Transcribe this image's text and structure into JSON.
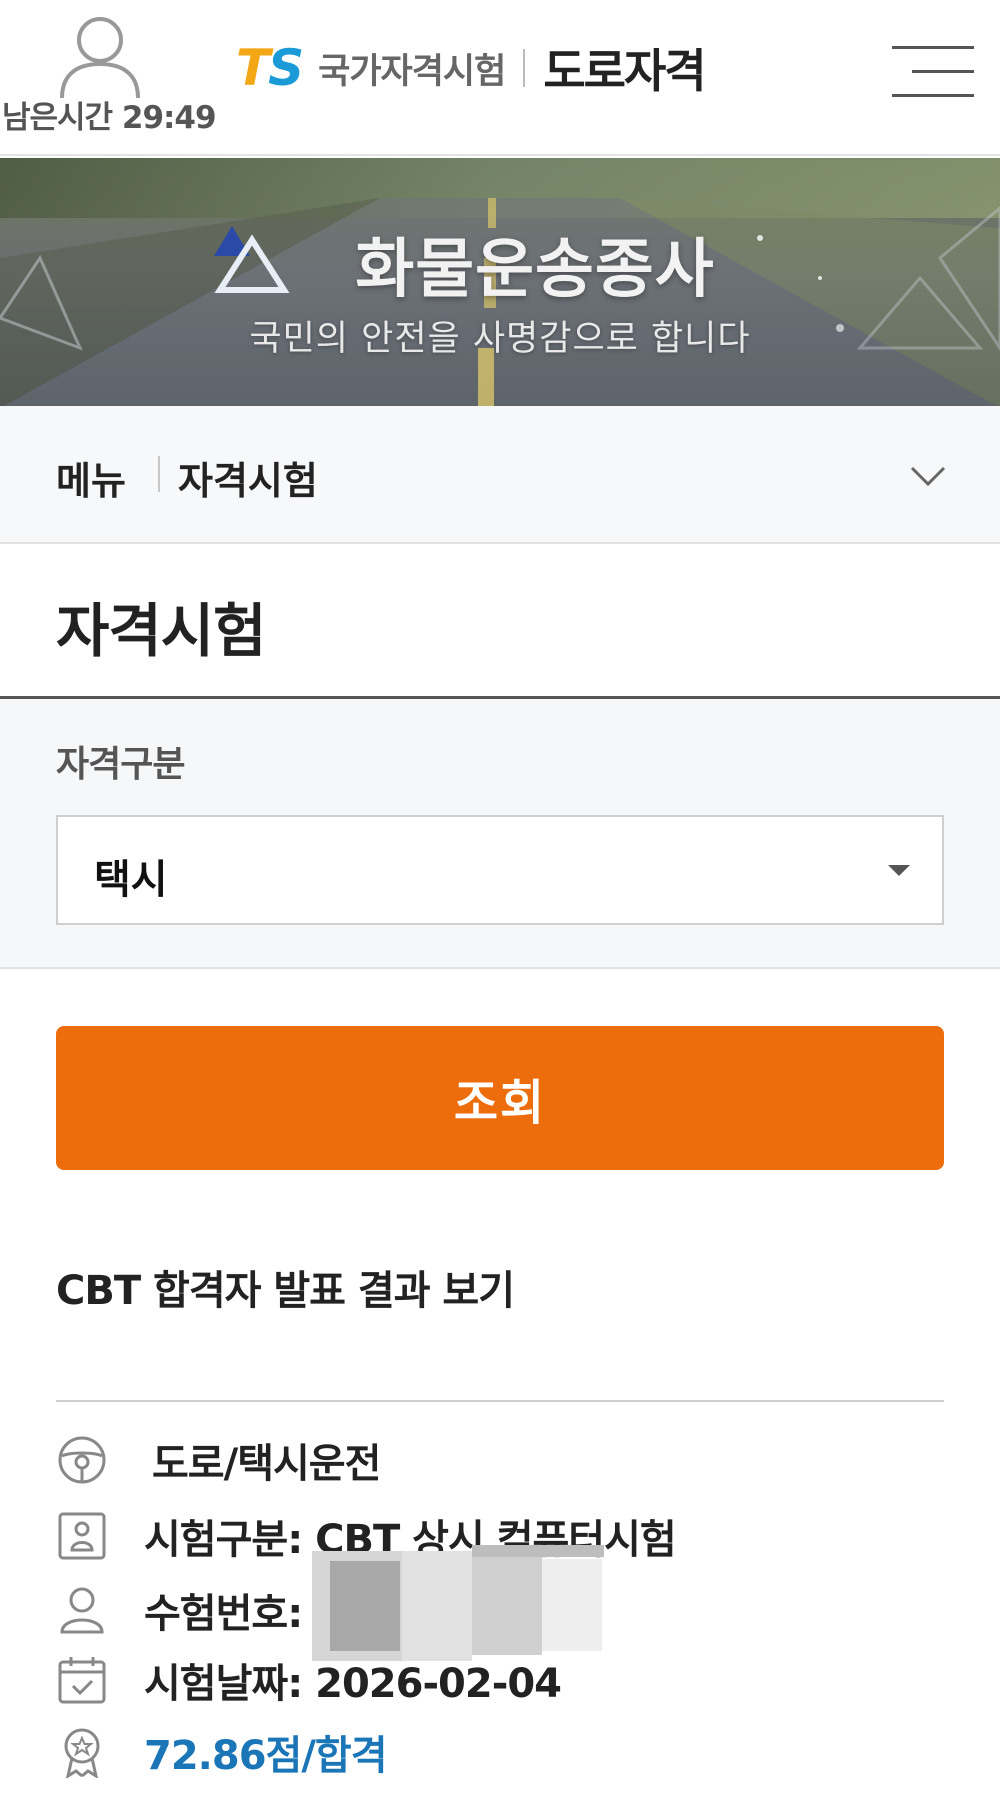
{
  "header": {
    "timer": "남은시간 29:49",
    "logo_t": "T",
    "logo_s": "S",
    "logo_sub": "국가자격시험",
    "logo_main": "도로자격",
    "icons": {
      "user": "user-icon",
      "menu": "hamburger-menu-icon"
    }
  },
  "banner": {
    "title": "화물운송종사",
    "subtitle": "국민의 안전을 사명감으로 합니다"
  },
  "breadcrumb": {
    "menu_label": "메뉴",
    "current": "자격시험",
    "icon": "chevron-down-icon"
  },
  "page": {
    "title": "자격시험"
  },
  "filter": {
    "label": "자격구분",
    "selected": "택시"
  },
  "search_button": {
    "label": "조회"
  },
  "results": {
    "heading": "CBT 합격자 발표 결과 보기",
    "course": "도로/택시운전",
    "exam_type": "시험구분: CBT 상시 컴퓨터시험",
    "exam_number_label": "수험번호:",
    "exam_date": "시험날짜: 2026-02-04",
    "score": "72.86점/합격",
    "score_color": "#1b76b8"
  },
  "colors": {
    "accent": "#ed6c0b",
    "logo_orange": "#f4a714",
    "logo_blue": "#1a9ad7"
  }
}
